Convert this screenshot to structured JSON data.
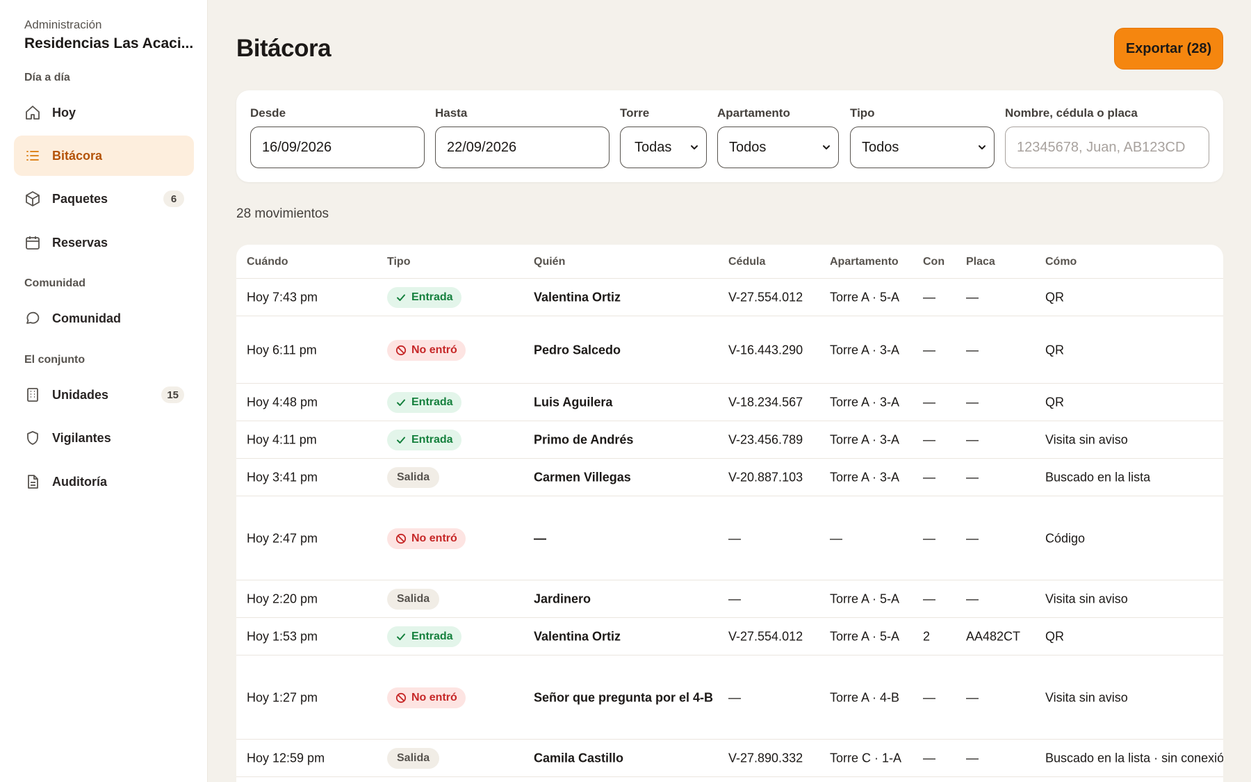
{
  "sidebar": {
    "org_label": "Administración",
    "org_name": "Residencias Las Acaci...",
    "sections": [
      "Día a día",
      "Comunidad",
      "El conjunto"
    ],
    "items": [
      {
        "label": "Hoy",
        "icon": "home-icon"
      },
      {
        "label": "Bitácora",
        "icon": "list-icon",
        "active": true
      },
      {
        "label": "Paquetes",
        "icon": "package-icon",
        "count": "6"
      },
      {
        "label": "Reservas",
        "icon": "calendar-icon"
      },
      {
        "label": "Comunidad",
        "icon": "chat-icon"
      },
      {
        "label": "Unidades",
        "icon": "building-icon",
        "count": "15"
      },
      {
        "label": "Vigilantes",
        "icon": "shield-icon"
      },
      {
        "label": "Auditoría",
        "icon": "document-icon"
      }
    ]
  },
  "header": {
    "title": "Bitácora",
    "export_label": "Exportar (28)"
  },
  "filters": {
    "desde": {
      "label": "Desde",
      "value": "16/09/2026"
    },
    "hasta": {
      "label": "Hasta",
      "value": "22/09/2026"
    },
    "torre": {
      "label": "Torre",
      "value": "Todas"
    },
    "apartamento": {
      "label": "Apartamento",
      "value": "Todos"
    },
    "tipo": {
      "label": "Tipo",
      "value": "Todos"
    },
    "busqueda": {
      "label": "Nombre, cédula o placa",
      "placeholder": "12345678, Juan, AB123CD"
    }
  },
  "results_count": "28 movimientos",
  "table": {
    "columns": [
      "Cuándo",
      "Tipo",
      "Quién",
      "Cédula",
      "Apartamento",
      "Con",
      "Placa",
      "Cómo"
    ],
    "rows": [
      {
        "cuando": "Hoy 7:43 pm",
        "tipo": "Entrada",
        "quien": "Valentina Ortiz",
        "cedula": "V-27.554.012",
        "apto": "Torre A · 5-A",
        "con": "—",
        "placa": "—",
        "como": "QR"
      },
      {
        "cuando": "Hoy 6:11 pm",
        "tipo": "No entró",
        "quien": "Pedro Salcedo",
        "cedula": "V-16.443.290",
        "apto": "Torre A · 3-A",
        "con": "—",
        "placa": "—",
        "como": "QR"
      },
      {
        "cuando": "Hoy 4:48 pm",
        "tipo": "Entrada",
        "quien": "Luis Aguilera",
        "cedula": "V-18.234.567",
        "apto": "Torre A · 3-A",
        "con": "—",
        "placa": "—",
        "como": "QR"
      },
      {
        "cuando": "Hoy 4:11 pm",
        "tipo": "Entrada",
        "quien": "Primo de Andrés",
        "cedula": "V-23.456.789",
        "apto": "Torre A · 3-A",
        "con": "—",
        "placa": "—",
        "como": "Visita sin aviso"
      },
      {
        "cuando": "Hoy 3:41 pm",
        "tipo": "Salida",
        "quien": "Carmen Villegas",
        "cedula": "V-20.887.103",
        "apto": "Torre A · 3-A",
        "con": "—",
        "placa": "—",
        "como": "Buscado en la lista"
      },
      {
        "cuando": "Hoy 2:47 pm",
        "tipo": "No entró",
        "quien": "—",
        "cedula": "—",
        "apto": "—",
        "con": "—",
        "placa": "—",
        "como": "Código"
      },
      {
        "cuando": "Hoy 2:20 pm",
        "tipo": "Salida",
        "quien": "Jardinero",
        "cedula": "—",
        "apto": "Torre A · 5-A",
        "con": "—",
        "placa": "—",
        "como": "Visita sin aviso"
      },
      {
        "cuando": "Hoy 1:53 pm",
        "tipo": "Entrada",
        "quien": "Valentina Ortiz",
        "cedula": "V-27.554.012",
        "apto": "Torre A · 5-A",
        "con": "2",
        "placa": "AA482CT",
        "como": "QR"
      },
      {
        "cuando": "Hoy 1:27 pm",
        "tipo": "No entró",
        "quien": "Señor que pregunta por el 4-B",
        "cedula": "—",
        "apto": "Torre A · 4-B",
        "con": "—",
        "placa": "—",
        "como": "Visita sin aviso"
      },
      {
        "cuando": "Hoy 12:59 pm",
        "tipo": "Salida",
        "quien": "Camila Castillo",
        "cedula": "V-27.890.332",
        "apto": "Torre C · 1-A",
        "con": "—",
        "placa": "—",
        "como": "Buscado en la lista · sin conexión"
      }
    ]
  },
  "colors": {
    "accent": "#f5860f",
    "active_nav_bg": "#fdeedd",
    "entrada": "#15803d",
    "no_entro": "#c62828"
  }
}
